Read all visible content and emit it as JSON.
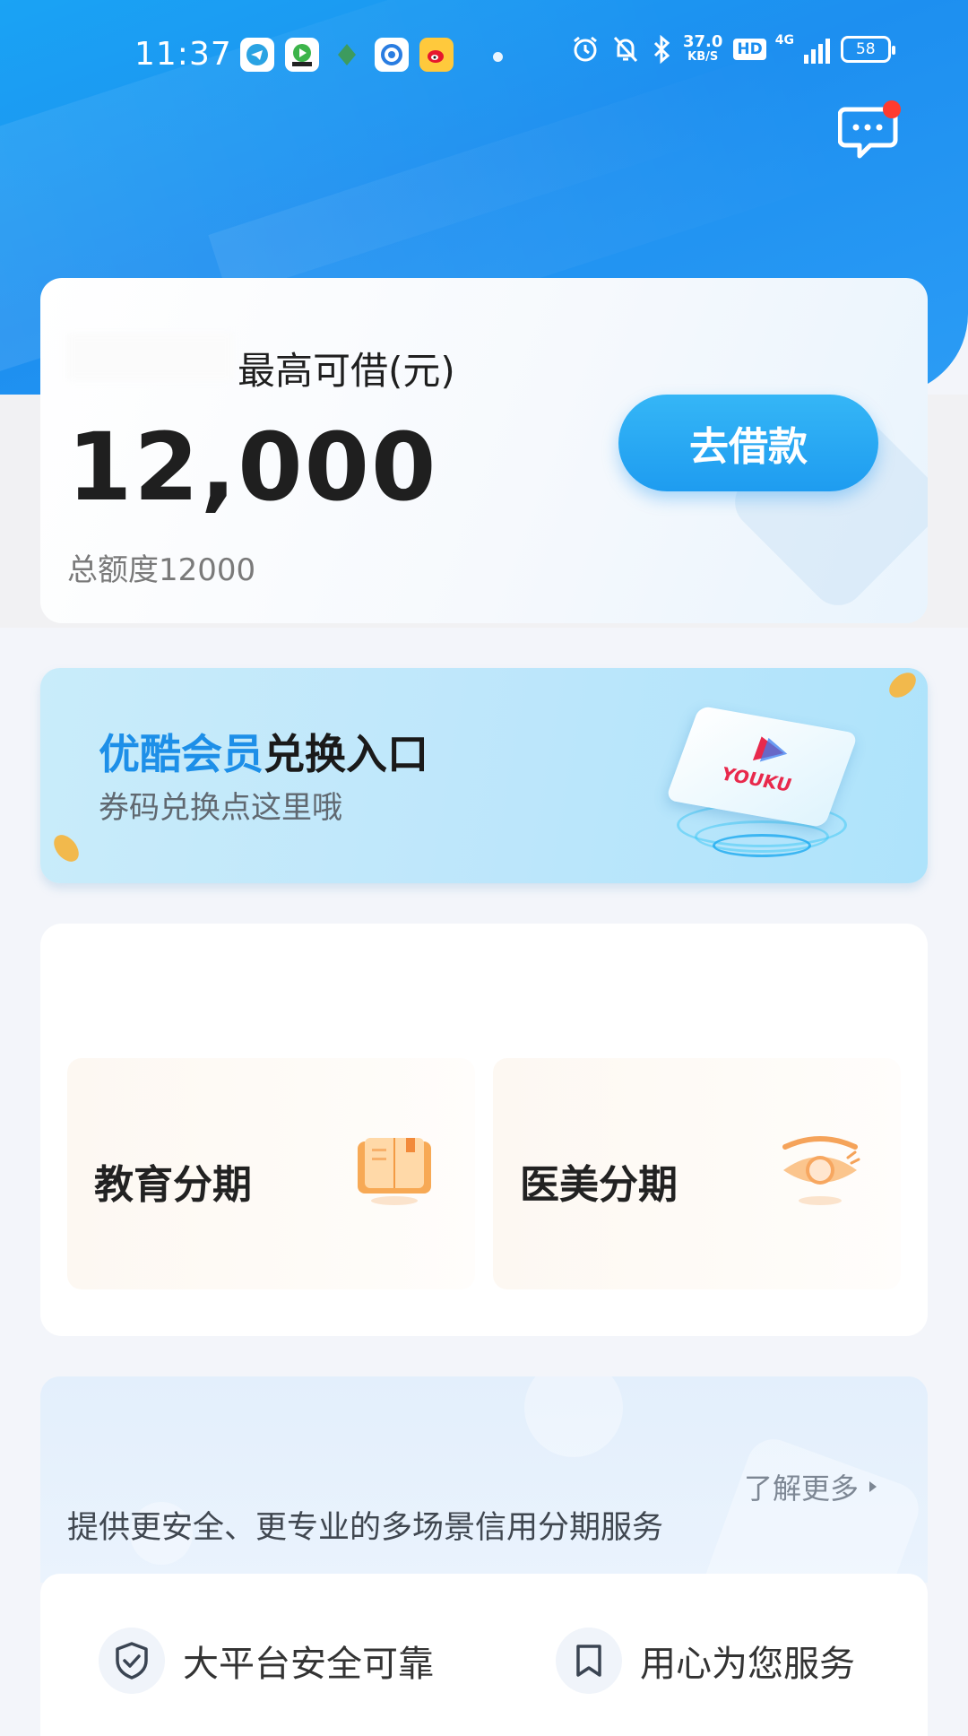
{
  "status_bar": {
    "time": "11:37",
    "net_speed_value": "37.0",
    "net_speed_unit": "KB/S",
    "hd": "HD",
    "network": "4G",
    "battery": "58"
  },
  "header": {
    "message_icon": "chat-bubble-icon"
  },
  "credit": {
    "max_label": "最高可借(元)",
    "amount": "12,000",
    "total_label": "总额度12000",
    "borrow_button": "去借款"
  },
  "youku_banner": {
    "title_highlight": "优酷会员",
    "title_rest": "兑换入口",
    "subtitle": "券码兑换点这里哦",
    "logo_text": "YOUKU"
  },
  "installments": [
    {
      "label": "教育分期",
      "icon": "book-icon"
    },
    {
      "label": "医美分期",
      "icon": "eye-icon"
    }
  ],
  "promo": {
    "learn_more": "了解更多",
    "description": "提供更安全、更专业的多场景信用分期服务"
  },
  "features": [
    {
      "label": "大平台安全可靠",
      "icon": "shield-check-icon"
    },
    {
      "label": "用心为您服务",
      "icon": "bookmark-icon"
    }
  ],
  "colors": {
    "primary_blue": "#1d8ff0",
    "button_blue": "#1e9cf0",
    "notification_red": "#ff3b2f",
    "accent_orange": "#f5a35a"
  }
}
